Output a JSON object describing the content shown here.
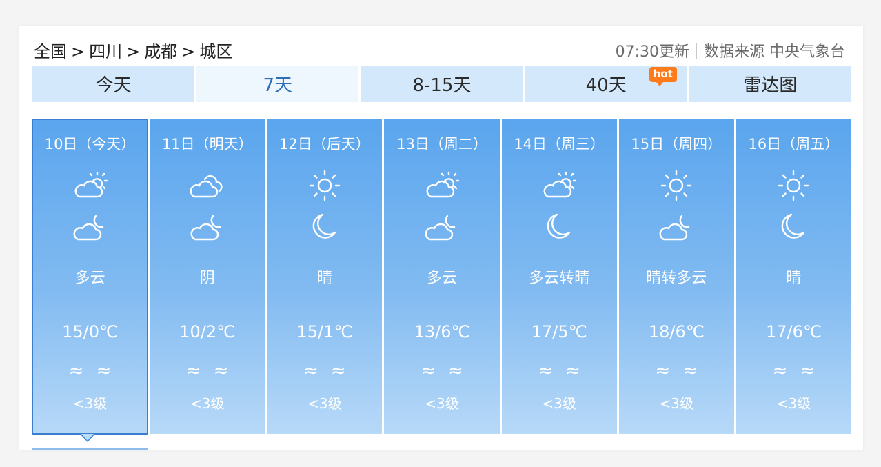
{
  "breadcrumb": {
    "items": [
      "全国",
      "四川",
      "成都",
      "城区"
    ],
    "separator": ">"
  },
  "meta": {
    "update_time": "07:30更新",
    "source": "数据来源 中央气象台"
  },
  "tabs": [
    {
      "label": "今天",
      "active": false
    },
    {
      "label": "7天",
      "active": true
    },
    {
      "label": "8-15天",
      "active": false
    },
    {
      "label": "40天",
      "active": false,
      "badge": "hot"
    },
    {
      "label": "雷达图",
      "active": false
    }
  ],
  "days": [
    {
      "date": "10日（今天）",
      "day_icon": "sun-cloud-icon",
      "night_icon": "moon-cloud-icon",
      "desc": "多云",
      "temp": "15/0℃",
      "wind": "≈≈",
      "level": "<3级",
      "selected": true
    },
    {
      "date": "11日（明天）",
      "day_icon": "overcast-icon",
      "night_icon": "moon-cloud-icon",
      "desc": "阴",
      "temp": "10/2℃",
      "wind": "≈≈",
      "level": "<3级",
      "selected": false
    },
    {
      "date": "12日（后天）",
      "day_icon": "sun-icon",
      "night_icon": "moon-icon",
      "desc": "晴",
      "temp": "15/1℃",
      "wind": "≈≈",
      "level": "<3级",
      "selected": false
    },
    {
      "date": "13日（周二）",
      "day_icon": "sun-cloud-icon",
      "night_icon": "moon-cloud-icon",
      "desc": "多云",
      "temp": "13/6℃",
      "wind": "≈≈",
      "level": "<3级",
      "selected": false
    },
    {
      "date": "14日（周三）",
      "day_icon": "sun-cloud-icon",
      "night_icon": "moon-icon",
      "desc": "多云转晴",
      "temp": "17/5℃",
      "wind": "≈≈",
      "level": "<3级",
      "selected": false
    },
    {
      "date": "15日（周四）",
      "day_icon": "sun-icon",
      "night_icon": "moon-cloud-icon",
      "desc": "晴转多云",
      "temp": "18/6℃",
      "wind": "≈≈",
      "level": "<3级",
      "selected": false
    },
    {
      "date": "16日（周五）",
      "day_icon": "sun-icon",
      "night_icon": "moon-icon",
      "desc": "晴",
      "temp": "17/6℃",
      "wind": "≈≈",
      "level": "<3级",
      "selected": false
    }
  ],
  "colors": {
    "tab_bg": "#d3e8fb",
    "tab_active_text": "#2f6fb8",
    "hot_badge": "#ff7a1a",
    "day_gradient_top": "#5aa5ee",
    "day_gradient_bottom": "#b7d9f8",
    "selected_border": "#3a7fcf"
  }
}
